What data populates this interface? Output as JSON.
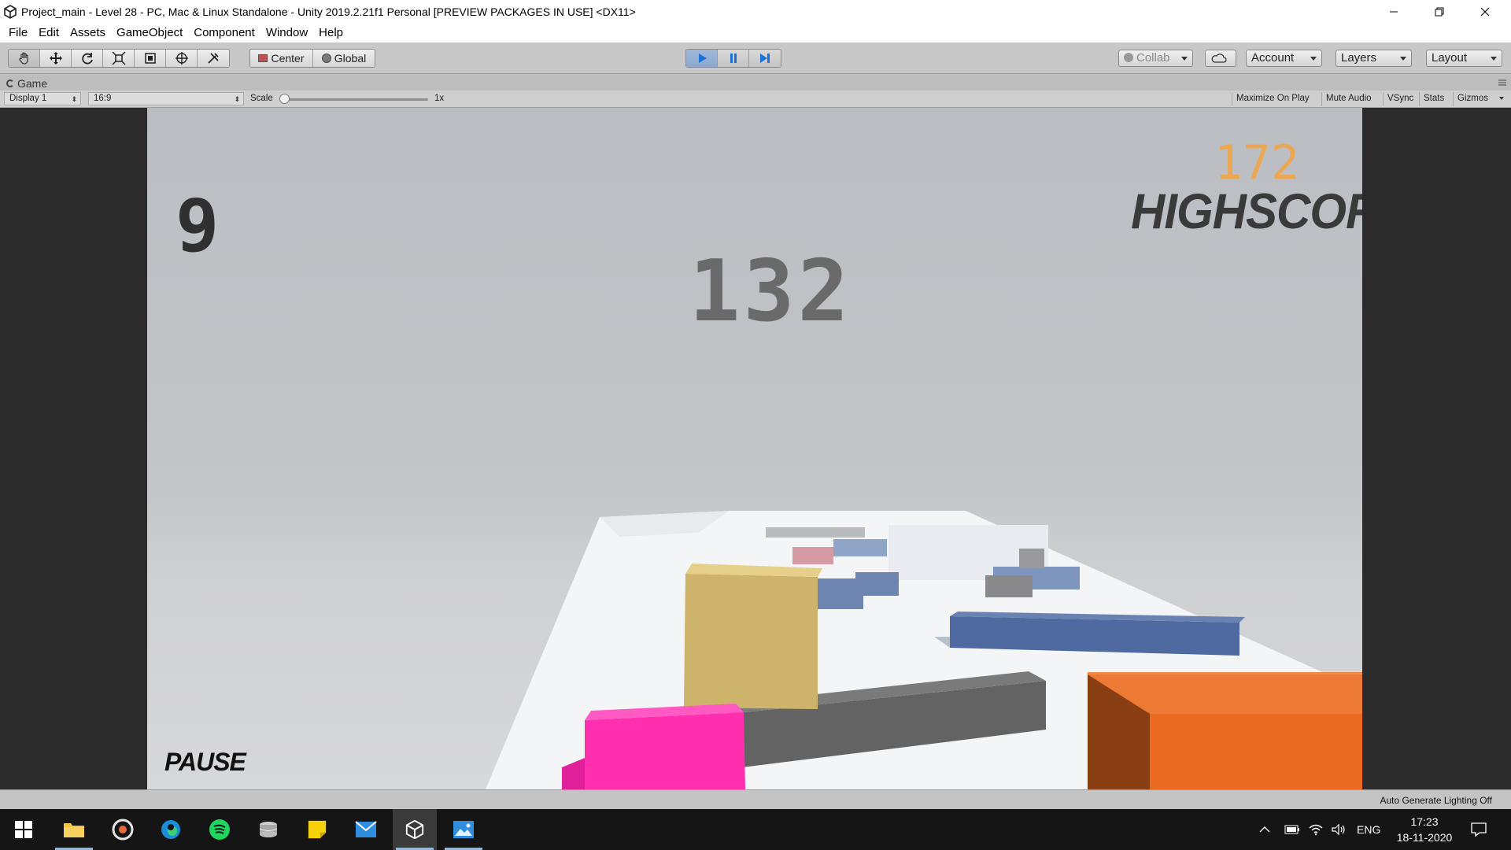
{
  "window": {
    "title": "Project_main - Level 28 - PC, Mac & Linux Standalone - Unity 2019.2.21f1 Personal [PREVIEW PACKAGES IN USE] <DX11>"
  },
  "menu": [
    "File",
    "Edit",
    "Assets",
    "GameObject",
    "Component",
    "Window",
    "Help"
  ],
  "toolbar": {
    "tools": [
      "hand-tool",
      "move-tool",
      "rotate-tool",
      "scale-tool",
      "rect-tool",
      "transform-tool",
      "custom-tool"
    ],
    "pivot_mode": "Center",
    "pivot_rotation": "Global",
    "play_state": "playing",
    "collab": "Collab",
    "account": "Account",
    "layers": "Layers",
    "layout": "Layout"
  },
  "game_view": {
    "tab_label": "Game",
    "display": "Display 1",
    "aspect": "16:9",
    "scale_label": "Scale",
    "scale_value": "1x",
    "toggles": [
      "Maximize On Play",
      "Mute Audio",
      "VSync",
      "Stats",
      "Gizmos"
    ]
  },
  "hud": {
    "counter": "9",
    "score": "132",
    "highscore_value": "172",
    "highscore_label": "HIGHSCORE",
    "pause_label": "PAUSE"
  },
  "status_bar": {
    "text": "Auto Generate Lighting Off"
  },
  "taskbar": {
    "apps": [
      "windows-start",
      "file-explorer",
      "media-player",
      "edge",
      "spotify",
      "storage-app",
      "sticky-notes",
      "mail",
      "unity",
      "photos"
    ],
    "language": "ENG",
    "time": "17:23",
    "date": "18-11-2020"
  },
  "colors": {
    "player_cube": "#cdb46a",
    "pink_block": "#ff2fb0",
    "orange_block": "#ea6a22",
    "blue_block": "#4e6aa0",
    "gray_block": "#6b6b6b",
    "highscore_value": "#f0a64a"
  }
}
